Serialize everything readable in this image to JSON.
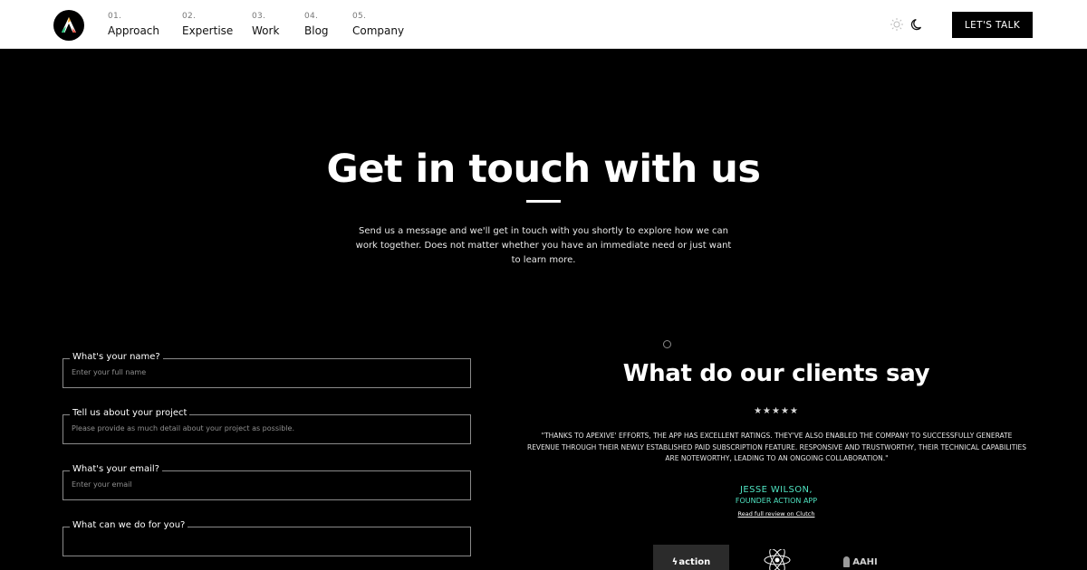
{
  "header": {
    "logo_icon": "apexive-logo-icon",
    "nav": [
      {
        "num": "01.",
        "label": "Approach"
      },
      {
        "num": "02.",
        "label": "Expertise"
      },
      {
        "num": "03.",
        "label": "Work"
      },
      {
        "num": "04.",
        "label": "Blog"
      },
      {
        "num": "05.",
        "label": "Company"
      }
    ],
    "theme_icons": [
      "sun-icon",
      "moon-icon"
    ],
    "cta_label": "LET'S  TALK"
  },
  "hero": {
    "title": "Get in touch with us",
    "subtitle": "Send us a message and we'll get in touch with you shortly to explore how we can work together. Does not matter whether you have an immediate need or just want to learn more."
  },
  "form": {
    "fields": [
      {
        "label": "What's your name?",
        "placeholder": "Enter your full name",
        "value": ""
      },
      {
        "label": "Tell us about your project",
        "placeholder": "Please provide as much detail about your project as possible.",
        "value": ""
      },
      {
        "label": "What's your email?",
        "placeholder": "Enter your email",
        "value": ""
      },
      {
        "label": "What can we do for you?",
        "placeholder": "",
        "value": ""
      }
    ]
  },
  "testimonials": {
    "title": "What do our clients say",
    "stars": "★★★★★",
    "rating": 5,
    "quote": "\"Thanks to Apexive' efforts, the app has excellent ratings. They've also enabled the company to successfully generate revenue through their newly established paid subscription feature. Responsive and trustworthy, their technical capabilities are noteworthy, leading to an ongoing collaboration.\"",
    "author": "JESSE WILSON,",
    "role": "FOUNDER ACTION APP",
    "link_label": "Read full review on Clutch",
    "clients": [
      "action",
      "atom-logo",
      "AAHI"
    ],
    "accent_color": "#4fe3c1"
  }
}
